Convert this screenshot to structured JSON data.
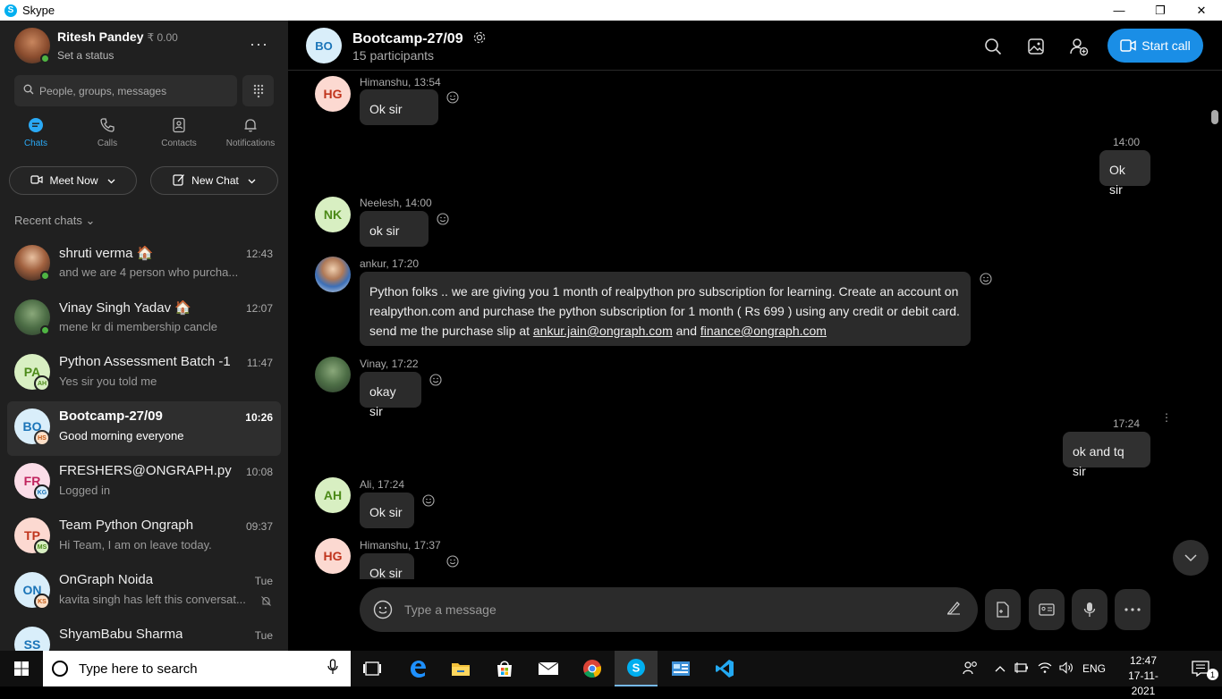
{
  "window": {
    "app_title": "Skype",
    "minimize": "—",
    "restore": "❐",
    "close": "✕"
  },
  "profile": {
    "name": "Ritesh Pandey",
    "credit": "₹ 0.00",
    "status": "Set a status",
    "more": "···"
  },
  "search": {
    "placeholder": "People, groups, messages"
  },
  "nav_tabs": [
    {
      "label": "Chats",
      "icon": "chat-icon"
    },
    {
      "label": "Calls",
      "icon": "phone-icon"
    },
    {
      "label": "Contacts",
      "icon": "contacts-icon"
    },
    {
      "label": "Notifications",
      "icon": "bell-icon"
    }
  ],
  "actions": {
    "meet_now": "Meet Now",
    "new_chat": "New Chat"
  },
  "recent_label": "Recent chats",
  "chats": [
    {
      "name": "shruti verma 🏠",
      "time": "12:43",
      "preview": "and we are 4 person who purcha...",
      "avatar_text": "",
      "sub_text": ""
    },
    {
      "name": "Vinay Singh Yadav 🏠",
      "time": "12:07",
      "preview": "mene kr di membership cancle",
      "avatar_text": "",
      "sub_text": ""
    },
    {
      "name": "Python Assessment Batch -1",
      "time": "11:47",
      "preview": "Yes sir you told me",
      "avatar_text": "PA",
      "sub_text": "AH"
    },
    {
      "name": "Bootcamp-27/09",
      "time": "10:26",
      "preview": "Good morning everyone",
      "avatar_text": "BO",
      "sub_text": "HS"
    },
    {
      "name": "FRESHERS@ONGRAPH.py",
      "time": "10:08",
      "preview": "Logged in",
      "avatar_text": "FR",
      "sub_text": "KG"
    },
    {
      "name": "Team Python Ongraph",
      "time": "09:37",
      "preview": "Hi Team, I am on leave today.",
      "avatar_text": "TP",
      "sub_text": "MS"
    },
    {
      "name": "OnGraph Noida",
      "time": "Tue",
      "preview": "kavita singh has left this conversat...",
      "avatar_text": "ON",
      "sub_text": "KS"
    },
    {
      "name": "ShyamBabu Sharma",
      "time": "Tue",
      "preview": "",
      "avatar_text": "SS",
      "sub_text": ""
    }
  ],
  "conversation": {
    "title": "Bootcamp-27/09",
    "avatar_text": "BO",
    "participants": "15 participants",
    "start_call": "Start call",
    "messages": [
      {
        "sender": "Himanshu, 13:54",
        "avatar_text": "HG",
        "text": "Ok sir"
      },
      {
        "time": "14:00",
        "text": "Ok sir"
      },
      {
        "sender": "Neelesh, 14:00",
        "avatar_text": "NK",
        "text": "ok sir"
      },
      {
        "sender": "ankur, 17:20",
        "avatar_text": "",
        "line1": "Python folks ..  we are giving you 1 month of  realpython pro subscription for learning. Create an account on",
        "line2": "realpython.com and purchase the python subscription for 1 month ( Rs 699 ) using any credit or debit card.",
        "line3_prefix": "send me the purchase slip at ",
        "link1": "ankur.jain@ongraph.com",
        "line3_mid": " and ",
        "link2": "finance@ongraph.com"
      },
      {
        "sender": "Vinay, 17:22",
        "avatar_text": "",
        "text": "okay sir"
      },
      {
        "time": "17:24",
        "text": "ok and tq sir"
      },
      {
        "sender": "Ali, 17:24",
        "avatar_text": "AH",
        "text": "Ok sir"
      },
      {
        "sender": "Himanshu, 17:37",
        "avatar_text": "HG",
        "text": "Ok sir"
      }
    ],
    "composer_placeholder": "Type a message"
  },
  "taskbar": {
    "search_placeholder": "Type here to search",
    "lang": "ENG",
    "time": "12:47",
    "date": "17-11-2021",
    "notif_count": "1"
  },
  "colors": {
    "accent": "#1a8ee6",
    "online": "#4fb443",
    "bubble": "#2b2b2b"
  }
}
